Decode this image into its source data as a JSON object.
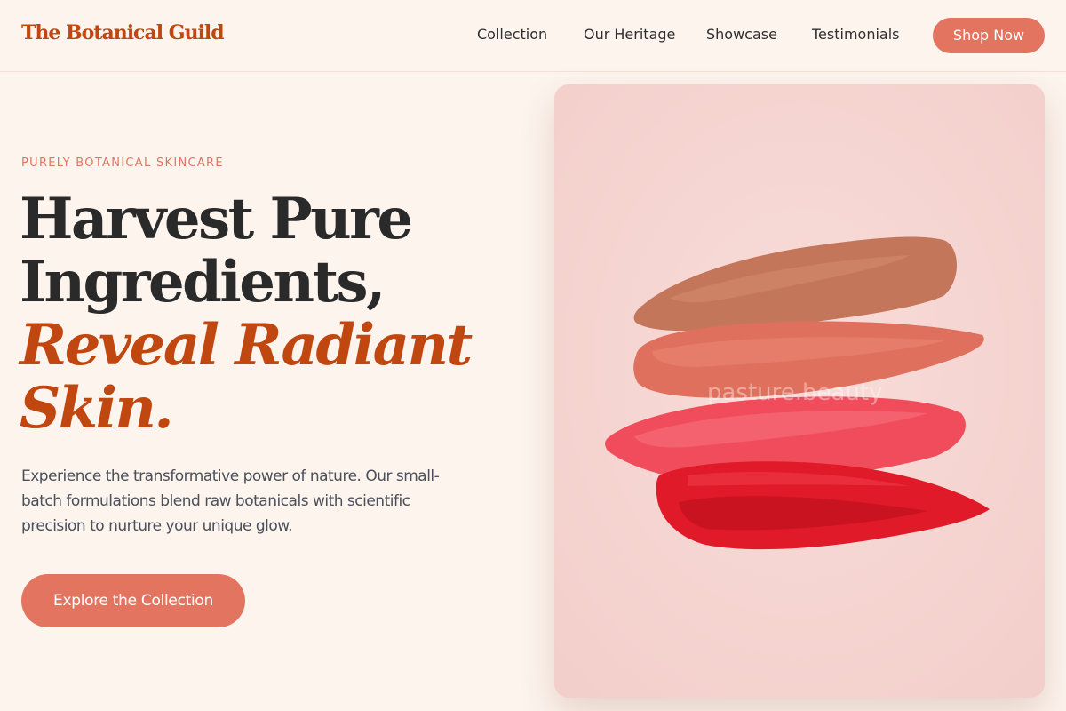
{
  "header": {
    "logo": "The Botanical Guild",
    "nav": [
      "Collection",
      "Our Heritage",
      "Showcase",
      "Testimonials"
    ],
    "cta": "Shop Now"
  },
  "hero": {
    "eyebrow": "PURELY BOTANICAL SKINCARE",
    "headline_line1": "Harvest Pure",
    "headline_line2": "Ingredients,",
    "headline_accent_line1": "Reveal Radiant",
    "headline_accent_line2": "Skin.",
    "description": "Experience the transformative power of nature. Our small-batch formulations blend raw botanicals with scientific precision to nurture your unique glow.",
    "cta": "Explore the Collection"
  },
  "image": {
    "watermark": "pasture.beauty",
    "swatch_colors": [
      "#c4765a",
      "#e0705e",
      "#f04c5c",
      "#e01a28"
    ],
    "background": "#f6d5d2"
  },
  "colors": {
    "brand": "#c0470f",
    "accent": "#e27460",
    "text": "#2a2a2a",
    "page_background": "#fdf4ee"
  }
}
